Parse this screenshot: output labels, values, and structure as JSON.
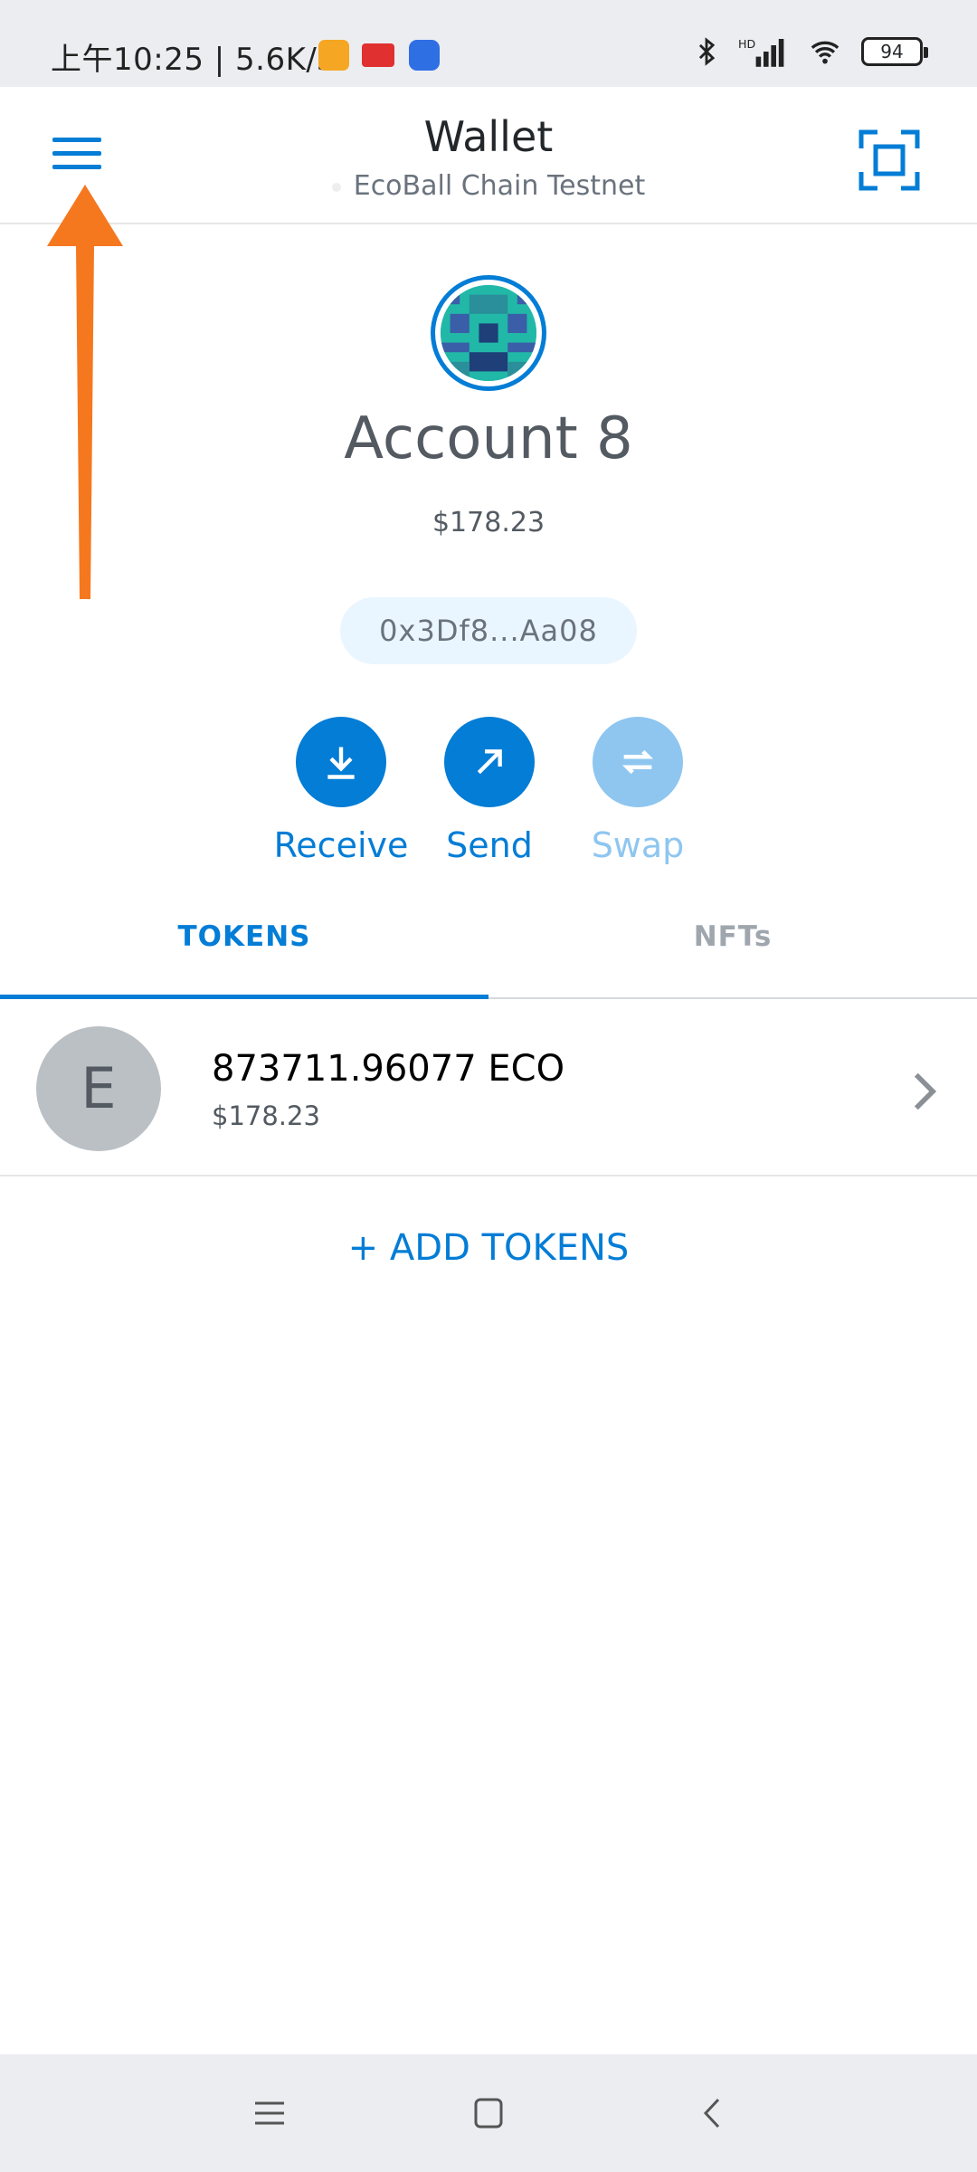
{
  "status_bar": {
    "time": "上午10:25 | 5.6K/s",
    "network_label": "HD",
    "battery": "94"
  },
  "header": {
    "title": "Wallet",
    "network": "EcoBall Chain Testnet"
  },
  "account": {
    "name": "Account 8",
    "balance": "$178.23",
    "address": "0x3Df8...Aa08"
  },
  "actions": [
    {
      "label": "Receive",
      "icon": "download-arrow-icon",
      "enabled": true
    },
    {
      "label": "Send",
      "icon": "diagonal-arrow-icon",
      "enabled": true
    },
    {
      "label": "Swap",
      "icon": "swap-arrows-icon",
      "enabled": false
    }
  ],
  "tabs": [
    {
      "label": "TOKENS",
      "active": true
    },
    {
      "label": "NFTs",
      "active": false
    }
  ],
  "tokens": [
    {
      "initial": "E",
      "amount": "873711.96077 ECO",
      "fiat": "$178.23"
    }
  ],
  "add_tokens_label": "+ ADD TOKENS",
  "colors": {
    "accent": "#037dd6",
    "accent_disabled": "#8ec6f0",
    "annotation_arrow": "#f5781f"
  }
}
